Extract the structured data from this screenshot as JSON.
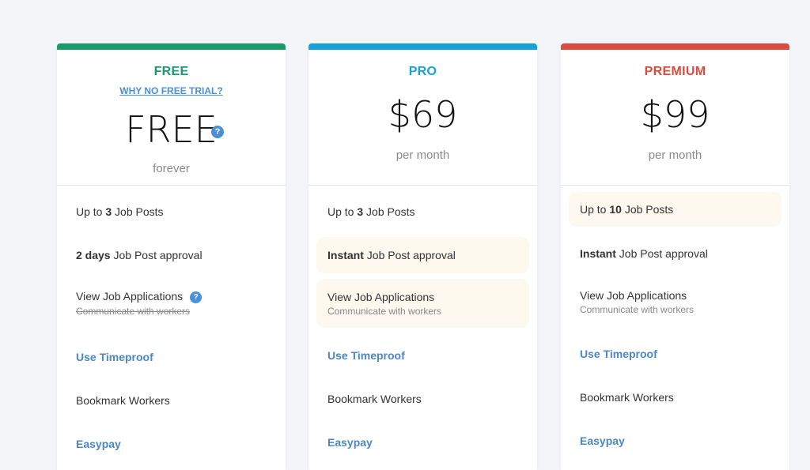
{
  "colors": {
    "free": "#1a9b6c",
    "pro": "#16a2d8",
    "premium": "#dd4b3e",
    "link": "#4a86c8",
    "highlight_bg": "#fef9ef",
    "page_bg": "#f3f5f9"
  },
  "plans": [
    {
      "name": "FREE",
      "trial_link": "WHY NO FREE TRIAL?",
      "price": "FREE",
      "price_help_icon": "?",
      "period": "forever",
      "features": [
        {
          "prefix": "Up to ",
          "bold": "3",
          "suffix": " Job Posts"
        },
        {
          "bold": "2 days",
          "suffix": " Job Post approval"
        },
        {
          "text": "View Job Applications",
          "help_icon": "?",
          "sub": "Communicate with workers",
          "sub_struck": true
        },
        {
          "link": "Use Timeproof"
        },
        {
          "text": "Bookmark Workers"
        },
        {
          "link": "Easypay"
        }
      ]
    },
    {
      "name": "PRO",
      "price": "$69",
      "period": "per month",
      "features": [
        {
          "prefix": "Up to ",
          "bold": "3",
          "suffix": " Job Posts"
        },
        {
          "bold": "Instant",
          "suffix": " Job Post approval",
          "highlighted": true
        },
        {
          "text": "View Job Applications",
          "sub": "Communicate with workers",
          "highlighted": true
        },
        {
          "link": "Use Timeproof"
        },
        {
          "text": "Bookmark Workers"
        },
        {
          "link": "Easypay"
        }
      ]
    },
    {
      "name": "PREMIUM",
      "price": "$99",
      "period": "per month",
      "features": [
        {
          "prefix": "Up to ",
          "bold": "10",
          "suffix": " Job Posts",
          "highlighted": true
        },
        {
          "bold": "Instant",
          "suffix": " Job Post approval"
        },
        {
          "text": "View Job Applications",
          "sub": "Communicate with workers"
        },
        {
          "link": "Use Timeproof"
        },
        {
          "text": "Bookmark Workers"
        },
        {
          "link": "Easypay"
        }
      ]
    }
  ]
}
